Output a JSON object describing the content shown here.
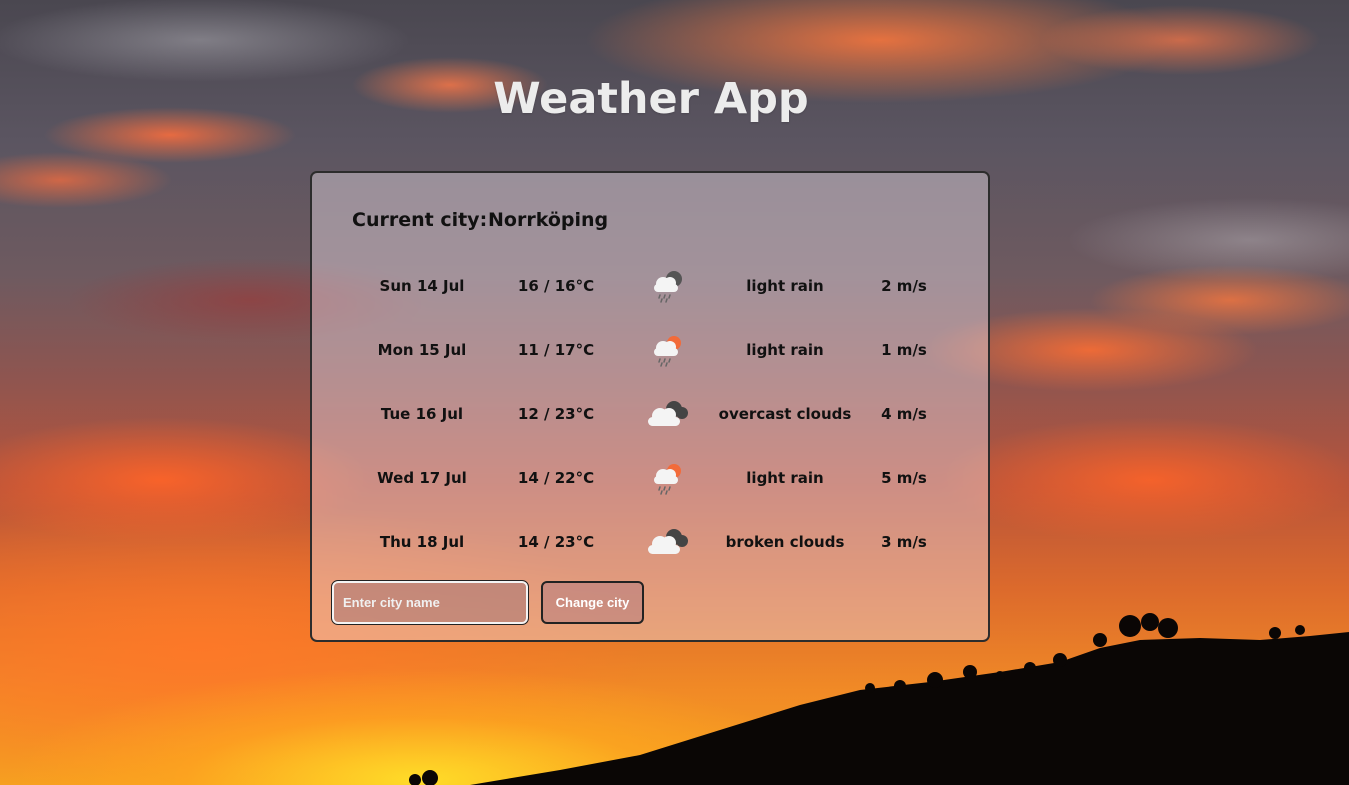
{
  "app": {
    "title": "Weather App"
  },
  "current_city": {
    "label": "Current city:",
    "name": "Norrköping"
  },
  "forecast": [
    {
      "date": "Sun 14 Jul",
      "temp": "16 / 16°C",
      "icon": "rain-night-icon",
      "description": "light rain",
      "wind": "2 m/s"
    },
    {
      "date": "Mon 15 Jul",
      "temp": "11 / 17°C",
      "icon": "rain-day-icon",
      "description": "light rain",
      "wind": "1 m/s"
    },
    {
      "date": "Tue 16 Jul",
      "temp": "12 / 23°C",
      "icon": "overcast-clouds-icon",
      "description": "overcast clouds",
      "wind": "4 m/s"
    },
    {
      "date": "Wed 17 Jul",
      "temp": "14 / 22°C",
      "icon": "rain-day-icon",
      "description": "light rain",
      "wind": "5 m/s"
    },
    {
      "date": "Thu 18 Jul",
      "temp": "14 / 23°C",
      "icon": "broken-clouds-icon",
      "description": "broken clouds",
      "wind": "3 m/s"
    }
  ],
  "search": {
    "value": "",
    "placeholder": "Enter city name",
    "button_label": "Change city"
  },
  "colors": {
    "title_text": "#ececec",
    "card_border": "#2c2c2c",
    "sun_accent": "#f26b3a",
    "cloud_dark": "#555555",
    "cloud_light": "#f4f4f4"
  }
}
